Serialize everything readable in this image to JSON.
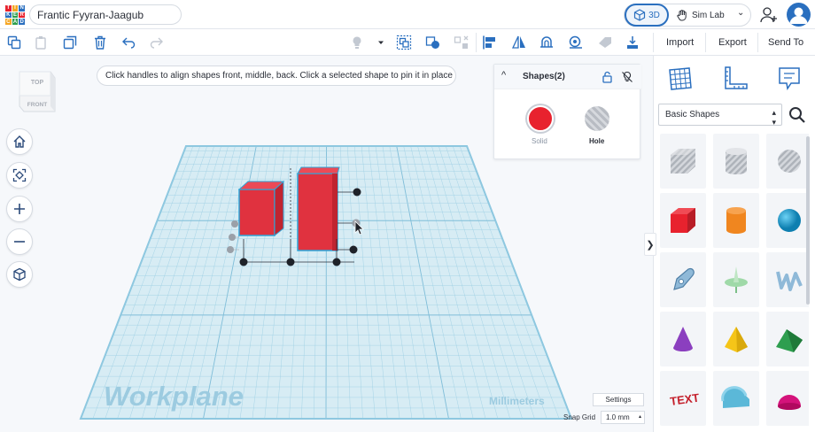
{
  "app": {
    "logo_letters": [
      "T",
      "I",
      "N",
      "K",
      "E",
      "R",
      "C",
      "A",
      "D"
    ],
    "logo_colors": [
      "#e8222e",
      "#f5a623",
      "#2a6fbf",
      "#2a6fbf",
      "#2e9e4f",
      "#e8222e",
      "#f5a623",
      "#2e9e4f",
      "#2a6fbf"
    ],
    "project_title": "Frantic Fyyran-Jaagub"
  },
  "header": {
    "view_3d_label": "3D",
    "sim_lab_label": "Sim Lab",
    "chevron": "⌄"
  },
  "toolbar": {
    "import_label": "Import",
    "export_label": "Export",
    "send_to_label": "Send To",
    "icons": [
      "copy-icon",
      "paste-icon",
      "duplicate-icon",
      "delete-icon",
      "undo-icon",
      "redo-icon",
      "light-icon",
      "dropdown-icon",
      "group-icon",
      "ungroup-icon",
      "align-icon",
      "mirror-icon",
      "cruise-icon",
      "workplane-icon",
      "ruler-icon",
      "drop-icon"
    ]
  },
  "viewport": {
    "viewcube_top": "TOP",
    "viewcube_front": "FRONT",
    "hint_text": "Click handles to align shapes front, middle, back. Click a selected shape to pin it in place",
    "workplane_label": "Workplane",
    "units_label": "Millimeters"
  },
  "shapes_panel": {
    "title": "Shapes(2)",
    "solid_label": "Solid",
    "hole_label": "Hole",
    "solid_color": "#e8222e",
    "collapse_glyph": "^"
  },
  "library": {
    "category": "Basic Shapes",
    "collapse_glyph": "❯",
    "shapes": [
      "Box Hole",
      "Cylinder Hole",
      "Sphere Hole",
      "Box",
      "Cylinder",
      "Sphere",
      "Scribble",
      "Paraboloid",
      "Text",
      "Cone",
      "Pyramid",
      "Roof",
      "Text",
      "Half Cylinder",
      "Half Sphere"
    ]
  },
  "footer": {
    "settings_label": "Settings",
    "snap_grid_label": "Snap Grid",
    "snap_grid_value": "1.0 mm",
    "snap_arrow": "▴"
  },
  "colors": {
    "accent": "#2a6fbf",
    "workplane": "#d7ecf4",
    "gridline": "#9fd0e4",
    "shape_red": "#e8222e",
    "shape_orange": "#f0861f",
    "shape_blue": "#1c9bd1",
    "shape_purple": "#8b3fbf",
    "shape_yellow": "#f5c518",
    "shape_green": "#2e9e4f"
  }
}
